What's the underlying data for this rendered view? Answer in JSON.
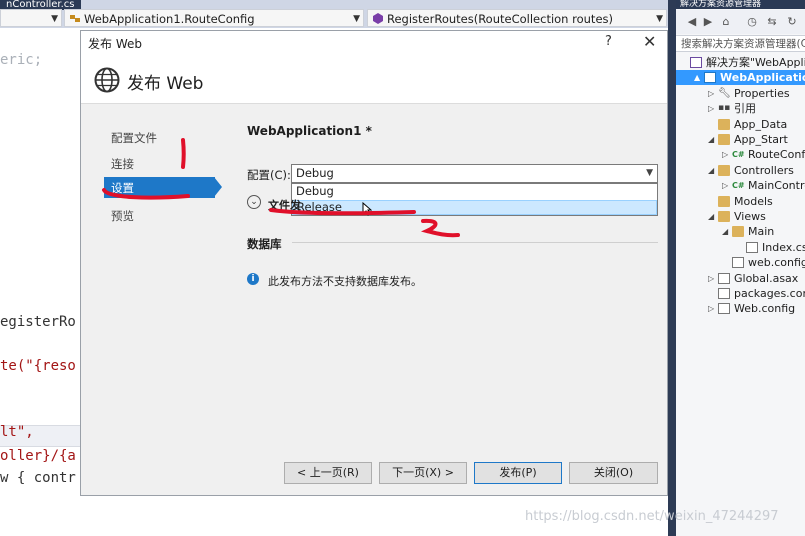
{
  "ide": {
    "doc_tab": "nController.cs",
    "navbar": {
      "class_combo": "WebApplication1.RouteConfig",
      "member_combo": "RegisterRoutes(RouteCollection routes)"
    },
    "code_lines": [
      "eric;",
      "egisterRo",
      "te(\"{reso",
      "lt\",",
      "oller}/{a",
      "w { contr"
    ]
  },
  "solution_explorer": {
    "title": "解决方案资源管理器",
    "search_placeholder": "搜索解决方案资源管理器(Ct",
    "tree": [
      {
        "label": "解决方案\"WebApplic",
        "indent": 0,
        "icon": "solution-icon",
        "twisty": ""
      },
      {
        "label": "WebApplication1",
        "indent": 1,
        "icon": "web-project-icon",
        "twisty": "▲",
        "selected": true
      },
      {
        "label": "Properties",
        "indent": 2,
        "icon": "wrench-icon",
        "twisty": "▷"
      },
      {
        "label": "引用",
        "indent": 2,
        "icon": "references-icon",
        "twisty": "▷"
      },
      {
        "label": "App_Data",
        "indent": 2,
        "icon": "folder-icon",
        "twisty": ""
      },
      {
        "label": "App_Start",
        "indent": 2,
        "icon": "folder-icon",
        "twisty": "◢"
      },
      {
        "label": "RouteConfi",
        "indent": 3,
        "icon": "csharp-file-icon",
        "twisty": "▷"
      },
      {
        "label": "Controllers",
        "indent": 2,
        "icon": "folder-icon",
        "twisty": "◢"
      },
      {
        "label": "MainContro",
        "indent": 3,
        "icon": "csharp-file-icon",
        "twisty": "▷"
      },
      {
        "label": "Models",
        "indent": 2,
        "icon": "folder-icon",
        "twisty": ""
      },
      {
        "label": "Views",
        "indent": 2,
        "icon": "folder-icon",
        "twisty": "◢"
      },
      {
        "label": "Main",
        "indent": 3,
        "icon": "folder-icon",
        "twisty": "◢"
      },
      {
        "label": "Index.cs",
        "indent": 4,
        "icon": "razor-file-icon",
        "twisty": ""
      },
      {
        "label": "web.config",
        "indent": 3,
        "icon": "config-file-icon",
        "twisty": ""
      },
      {
        "label": "Global.asax",
        "indent": 2,
        "icon": "asax-file-icon",
        "twisty": "▷"
      },
      {
        "label": "packages.conf",
        "indent": 2,
        "icon": "config-file-icon",
        "twisty": ""
      },
      {
        "label": "Web.config",
        "indent": 2,
        "icon": "config-file-icon",
        "twisty": "▷"
      }
    ]
  },
  "dialog": {
    "title": "发布 Web",
    "help": "?",
    "close": "✕",
    "header": "发布 Web",
    "nav": {
      "profile": "配置文件",
      "connection": "连接",
      "settings": "设置",
      "preview": "预览"
    },
    "profile_name": "WebApplication1 *",
    "config_label": "配置(C):",
    "config_value": "Debug",
    "config_options": [
      "Debug",
      "Release"
    ],
    "highlighted_option": "Release",
    "file_options_label": "文件发",
    "database_title": "数据库",
    "database_info": "此发布方法不支持数据库发布。",
    "buttons": {
      "prev": "< 上一页(R)",
      "next": "下一页(X) >",
      "publish": "发布(P)",
      "close": "关闭(O)"
    }
  },
  "watermark": "https://blog.csdn.net/weixin_47244297",
  "colors": {
    "accent": "#1e78c8",
    "selection": "#3399ff",
    "annotation": "#e0102a"
  }
}
